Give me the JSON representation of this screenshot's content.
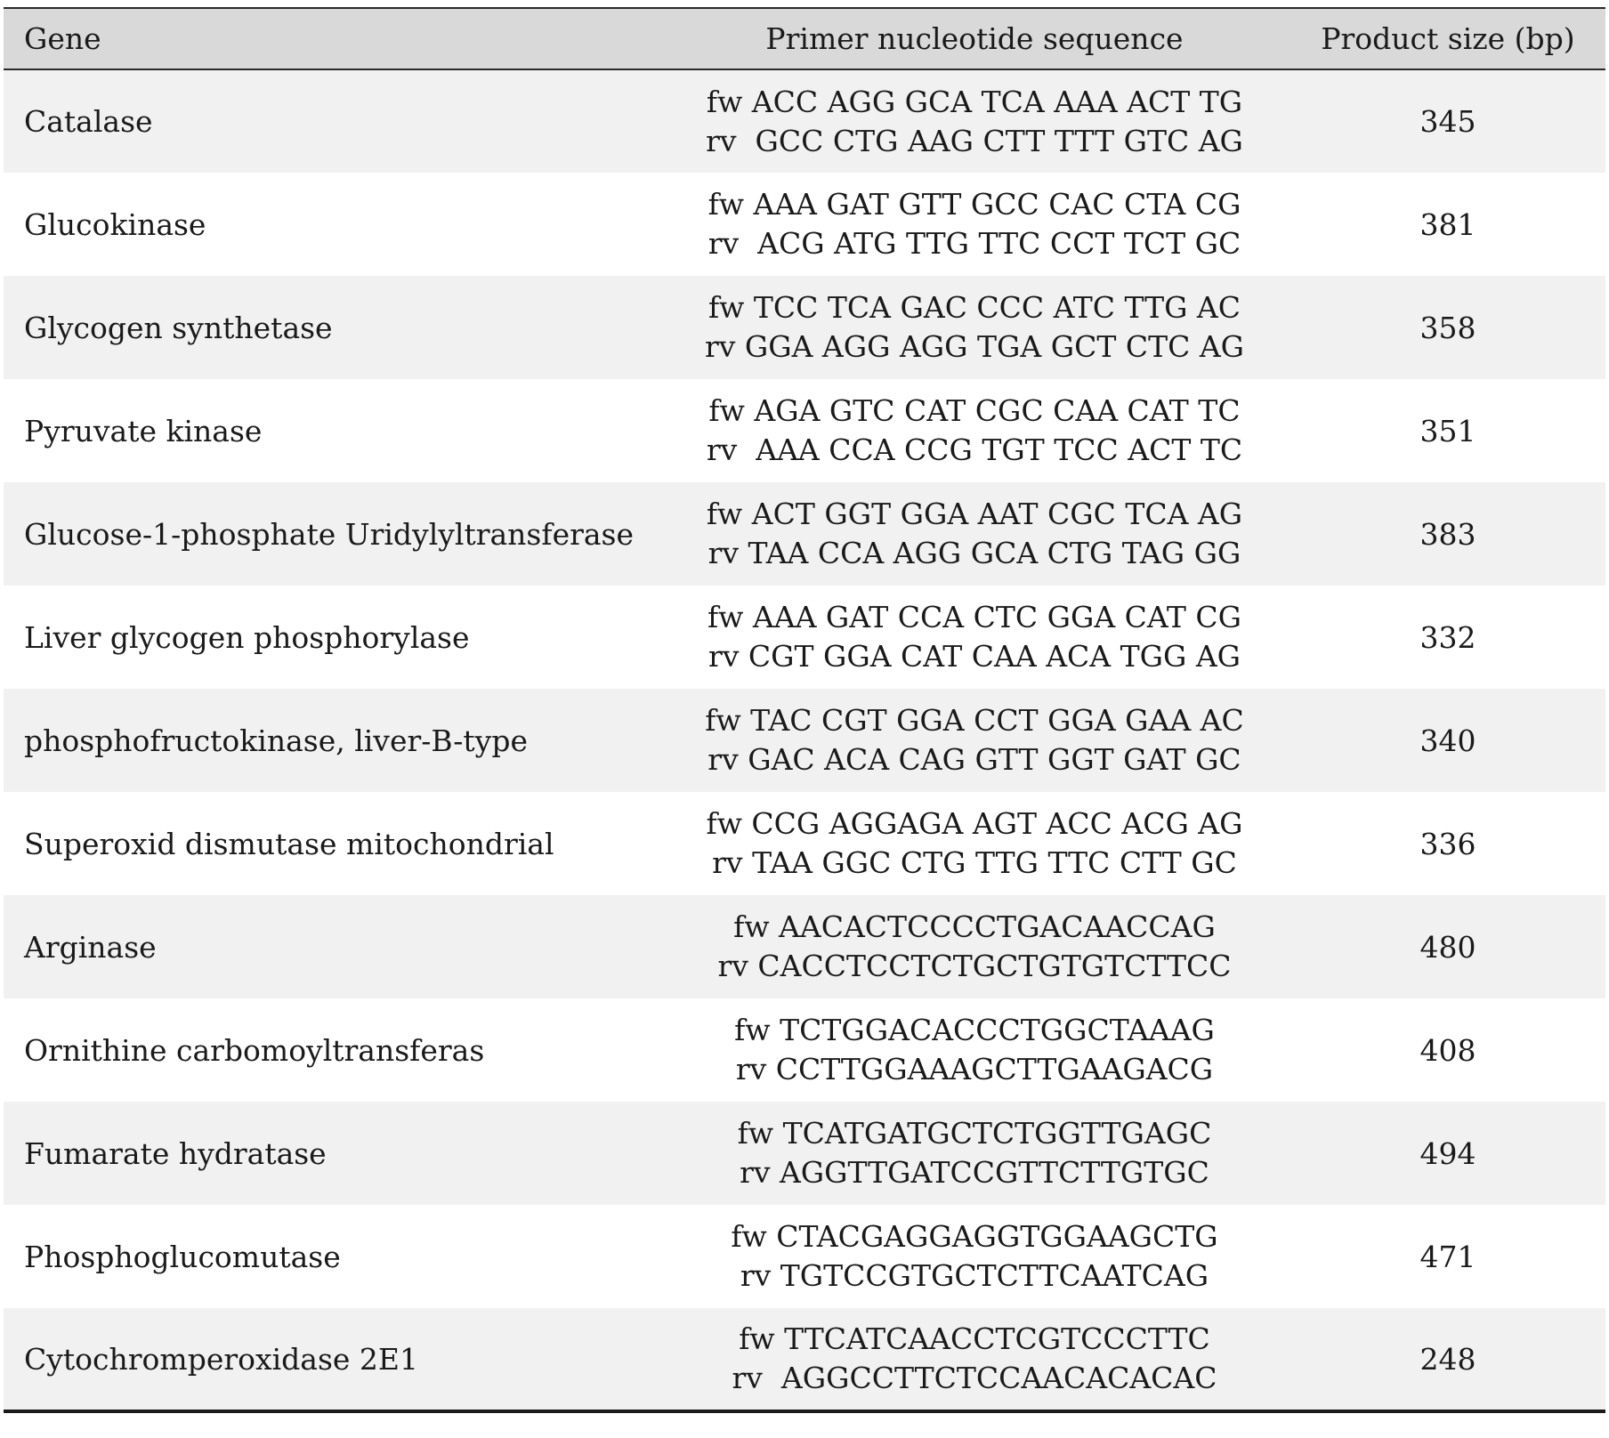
{
  "table": {
    "headers": {
      "gene": "Gene",
      "primer": "Primer nucleotide sequence",
      "size": "Product size (bp)"
    },
    "rows": [
      {
        "gene": "Catalase",
        "fw": "fw ACC AGG GCA TCA AAA ACT TG",
        "rv": "rv  GCC CTG AAG CTT TTT GTC AG",
        "size": "345"
      },
      {
        "gene": "Glucokinase",
        "fw": "fw AAA GAT GTT GCC CAC CTA CG",
        "rv": "rv  ACG ATG TTG TTC CCT TCT GC",
        "size": "381"
      },
      {
        "gene": "Glycogen synthetase",
        "fw": "fw TCC TCA GAC CCC ATC TTG AC",
        "rv": "rv GGA AGG AGG TGA GCT CTC AG",
        "size": "358"
      },
      {
        "gene": "Pyruvate kinase",
        "fw": "fw AGA GTC CAT CGC CAA CAT TC",
        "rv": "rv  AAA CCA CCG TGT TCC ACT TC",
        "size": "351"
      },
      {
        "gene": "Glucose-1-phosphate Uridylyltransferase",
        "fw": "fw ACT GGT GGA AAT CGC TCA AG",
        "rv": "rv TAA CCA AGG GCA CTG TAG GG",
        "size": "383"
      },
      {
        "gene": "Liver glycogen phosphorylase",
        "fw": "fw AAA GAT CCA CTC GGA CAT CG",
        "rv": "rv CGT GGA CAT CAA ACA TGG AG",
        "size": "332"
      },
      {
        "gene": "phosphofructokinase, liver-B-type",
        "fw": "fw TAC CGT GGA CCT GGA GAA AC",
        "rv": "rv GAC ACA CAG GTT GGT GAT GC",
        "size": "340"
      },
      {
        "gene": "Superoxid dismutase mitochondrial",
        "fw": "fw CCG AGGAGA AGT ACC ACG AG",
        "rv": "rv TAA GGC CTG TTG TTC CTT GC",
        "size": "336"
      },
      {
        "gene": "Arginase",
        "fw": "fw AACACTCCCCTGACAACCAG",
        "rv": "rv CACCTCCTCTGCTGTGTCTTCC",
        "size": "480"
      },
      {
        "gene": "Ornithine carbomoyltransferas",
        "fw": "fw TCTGGACACCCTGGCTAAAG",
        "rv": "rv CCTTGGAAAGCTTGAAGACG",
        "size": "408"
      },
      {
        "gene": "Fumarate hydratase",
        "fw": "fw TCATGATGCTCTGGTTGAGC",
        "rv": "rv AGGTTGATCCGTTCTTGTGC",
        "size": "494"
      },
      {
        "gene": "Phosphoglucomutase",
        "fw": "fw CTACGAGGAGGTGGAAGCTG",
        "rv": "rv TGTCCGTGCTCTTCAATCAG",
        "size": "471"
      },
      {
        "gene": "Cytochromperoxidase 2E1",
        "fw": "fw TTCATCAACCTCGTCCCTTC",
        "rv": "rv  AGGCCTTCTCCAACACACAC",
        "size": "248"
      }
    ]
  }
}
